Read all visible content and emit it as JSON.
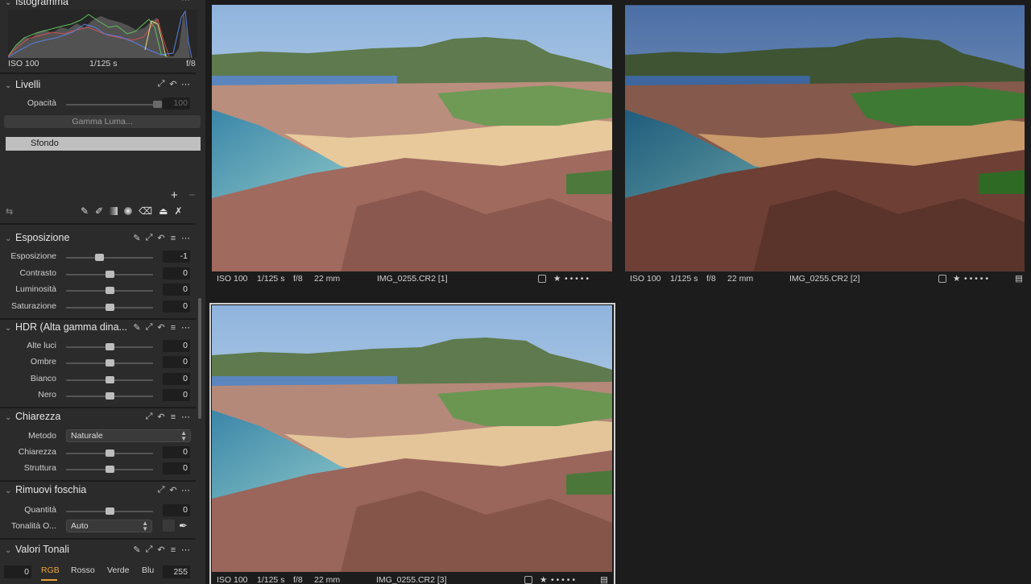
{
  "histogram": {
    "title": "Istogramma",
    "iso": "ISO 100",
    "shutter": "1/125 s",
    "aperture": "f/8"
  },
  "levels": {
    "title": "Livelli",
    "opacity_label": "Opacità",
    "opacity_value": "100",
    "gamma_button": "Gamma Luma...",
    "layer_name": "Sfondo"
  },
  "exposure": {
    "title": "Esposizione",
    "sliders": [
      {
        "label": "Esposizione",
        "value": "-1",
        "pos": 0.38
      },
      {
        "label": "Contrasto",
        "value": "0",
        "pos": 0.5
      },
      {
        "label": "Luminosità",
        "value": "0",
        "pos": 0.5
      },
      {
        "label": "Saturazione",
        "value": "0",
        "pos": 0.5
      }
    ]
  },
  "hdr": {
    "title": "HDR (Alta gamma dina...",
    "sliders": [
      {
        "label": "Alte luci",
        "value": "0",
        "pos": 0.5
      },
      {
        "label": "Ombre",
        "value": "0",
        "pos": 0.5
      },
      {
        "label": "Bianco",
        "value": "0",
        "pos": 0.5
      },
      {
        "label": "Nero",
        "value": "0",
        "pos": 0.5
      }
    ]
  },
  "clarity": {
    "title": "Chiarezza",
    "method_label": "Metodo",
    "method_value": "Naturale",
    "sliders": [
      {
        "label": "Chiarezza",
        "value": "0",
        "pos": 0.5
      },
      {
        "label": "Struttura",
        "value": "0",
        "pos": 0.5
      }
    ]
  },
  "dehaze": {
    "title": "Rimuovi foschia",
    "amount_label": "Quantità",
    "amount_value": "0",
    "amount_pos": 0.5,
    "tone_label": "Tonalità O...",
    "tone_value": "Auto"
  },
  "levels_tonal": {
    "title": "Valori Tonali",
    "low": "0",
    "high": "255",
    "channels": [
      "RGB",
      "Rosso",
      "Verde",
      "Blu"
    ],
    "active_channel_color": "#e8a33a"
  },
  "photos": [
    {
      "iso": "ISO 100",
      "shutter": "1/125 s",
      "aperture": "f/8",
      "focal": "22 mm",
      "filename": "IMG_0255.CR2 [1]",
      "rating_dots": "• • • • •"
    },
    {
      "iso": "ISO 100",
      "shutter": "1/125 s",
      "aperture": "f/8",
      "focal": "22 mm",
      "filename": "IMG_0255.CR2 [2]",
      "rating_dots": "• • • • •"
    },
    {
      "iso": "ISO 100",
      "shutter": "1/125 s",
      "aperture": "f/8",
      "focal": "22 mm",
      "filename": "IMG_0255.CR2 [3]",
      "rating_dots": "• • • • •"
    }
  ]
}
